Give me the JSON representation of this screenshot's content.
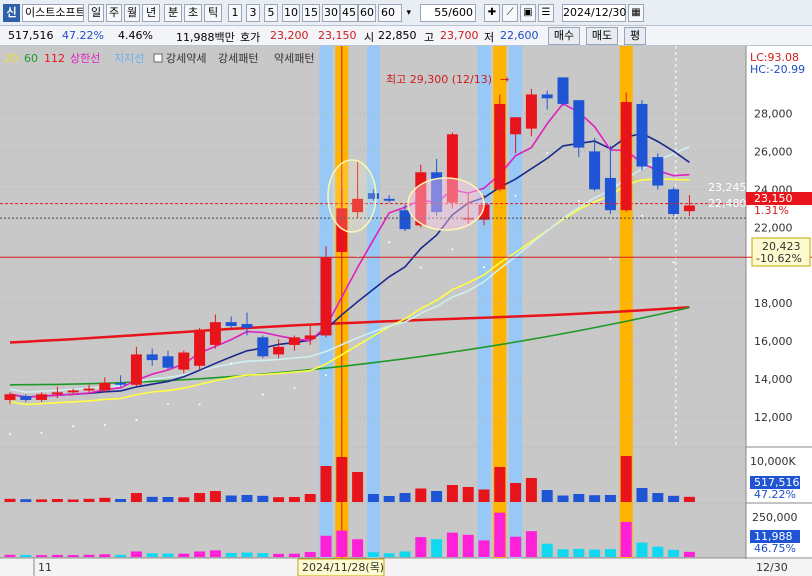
{
  "toolbar": {
    "badge": "신",
    "stock_name": "이스트소프트",
    "periods": [
      "일",
      "주",
      "월",
      "년",
      "분",
      "초",
      "틱"
    ],
    "selected_period": "일",
    "intervals": [
      "1",
      "3",
      "5",
      "10",
      "15",
      "30",
      "45",
      "60"
    ],
    "interval_dropdown": "60",
    "count_value": "55",
    "count_total": "/600",
    "date_value": "2024/12/30"
  },
  "quote": {
    "volume": "517,516",
    "volume_ratio": "47.22%",
    "change_rate": "4.46%",
    "amount": "11,988백만",
    "ask_label": "호가",
    "ask": "23,200",
    "bid": "23,150",
    "open_label": "시",
    "open": "22,850",
    "high_label": "고",
    "high": "23,700",
    "low_label": "저",
    "low": "22,600",
    "buy_button": "매수",
    "sell_button": "매도",
    "eval_button": "평"
  },
  "legend": {
    "ma20": "20",
    "ma60": "60",
    "ma112": "112",
    "upper_limit": "상한선",
    "support": "지지선",
    "check_label": "강세약세",
    "pattern_strong": "강세패턴",
    "pattern_weak": "약세패턴"
  },
  "price_axis": {
    "ticks": [
      "28,000",
      "26,000",
      "24,000",
      "22,000",
      "18,000",
      "16,000",
      "14,000",
      "12,000"
    ],
    "lc": "LC:93.08",
    "hc": "HC:-20.99",
    "current_price": "23,150",
    "current_rate": "1.31%",
    "ref_price": "20,423",
    "ref_rate": "-10.62%",
    "line_a": "23,245",
    "line_b": "22,480"
  },
  "annotation": "최고 29,300 (12/13)",
  "volume_axis": {
    "tick": "10,000K",
    "value": "517,516",
    "ratio": "47.22%"
  },
  "amount_axis": {
    "tick": "250,000",
    "value": "11,988",
    "ratio": "46.75%"
  },
  "date_axis": {
    "month_label": "11",
    "crosshair_date": "2024/11/28(목)",
    "end_date": "12/30"
  },
  "colors": {
    "up": "#e8141b",
    "down": "#1f55d4",
    "ma5": "#e020c0",
    "ma10": "#1a2a8c",
    "ma20": "#ffff40",
    "ma60": "#1f9a2a",
    "ma112": "#e8141b",
    "ma_light": "#cfeff0",
    "highlight_blue": "#98c8f5",
    "highlight_orange": "#ffb400"
  },
  "chart_data": {
    "type": "candlestick",
    "price_min": 11000,
    "price_max": 30500,
    "candles": [
      {
        "o": 12900,
        "h": 13300,
        "l": 12700,
        "c": 13200,
        "v": 320,
        "a": 120
      },
      {
        "o": 13100,
        "h": 13200,
        "l": 12800,
        "c": 12900,
        "v": 280,
        "a": 110
      },
      {
        "o": 12900,
        "h": 13300,
        "l": 12800,
        "c": 13200,
        "v": 260,
        "a": 100
      },
      {
        "o": 13200,
        "h": 13600,
        "l": 13000,
        "c": 13300,
        "v": 300,
        "a": 115
      },
      {
        "o": 13300,
        "h": 13500,
        "l": 13200,
        "c": 13400,
        "v": 250,
        "a": 105
      },
      {
        "o": 13400,
        "h": 13700,
        "l": 13300,
        "c": 13500,
        "v": 320,
        "a": 120
      },
      {
        "o": 13400,
        "h": 14100,
        "l": 13300,
        "c": 13800,
        "v": 420,
        "a": 150
      },
      {
        "o": 13800,
        "h": 14200,
        "l": 13600,
        "c": 13700,
        "v": 300,
        "a": 120
      },
      {
        "o": 13700,
        "h": 15700,
        "l": 13600,
        "c": 15300,
        "v": 900,
        "a": 300
      },
      {
        "o": 15300,
        "h": 15600,
        "l": 14700,
        "c": 15000,
        "v": 520,
        "a": 200
      },
      {
        "o": 15200,
        "h": 15500,
        "l": 14500,
        "c": 14600,
        "v": 500,
        "a": 190
      },
      {
        "o": 14500,
        "h": 15500,
        "l": 14300,
        "c": 15400,
        "v": 470,
        "a": 180
      },
      {
        "o": 14700,
        "h": 16700,
        "l": 14500,
        "c": 16600,
        "v": 900,
        "a": 300
      },
      {
        "o": 15800,
        "h": 17400,
        "l": 15600,
        "c": 17000,
        "v": 1100,
        "a": 360
      },
      {
        "o": 17000,
        "h": 17300,
        "l": 16700,
        "c": 16800,
        "v": 650,
        "a": 220
      },
      {
        "o": 16900,
        "h": 17500,
        "l": 16300,
        "c": 16700,
        "v": 700,
        "a": 240
      },
      {
        "o": 16200,
        "h": 16300,
        "l": 15100,
        "c": 15200,
        "v": 620,
        "a": 210
      },
      {
        "o": 15300,
        "h": 16100,
        "l": 15100,
        "c": 15700,
        "v": 480,
        "a": 170
      },
      {
        "o": 15800,
        "h": 16300,
        "l": 15500,
        "c": 16200,
        "v": 500,
        "a": 180
      },
      {
        "o": 16100,
        "h": 16900,
        "l": 15800,
        "c": 16300,
        "v": 800,
        "a": 270
      },
      {
        "o": 16300,
        "h": 21000,
        "l": 16200,
        "c": 20400,
        "v": 3600,
        "a": 1150
      },
      {
        "o": 20700,
        "h": 24000,
        "l": 20600,
        "c": 23000,
        "v": 4500,
        "a": 1430
      },
      {
        "o": 22800,
        "h": 25500,
        "l": 22500,
        "c": 23500,
        "v": 3000,
        "a": 960
      },
      {
        "o": 23800,
        "h": 24000,
        "l": 23400,
        "c": 23500,
        "v": 800,
        "a": 260
      },
      {
        "o": 23500,
        "h": 23700,
        "l": 23300,
        "c": 23400,
        "v": 600,
        "a": 200
      },
      {
        "o": 22900,
        "h": 23200,
        "l": 21800,
        "c": 21900,
        "v": 900,
        "a": 300
      },
      {
        "o": 22100,
        "h": 25300,
        "l": 22000,
        "c": 24900,
        "v": 1350,
        "a": 1080
      },
      {
        "o": 24900,
        "h": 25600,
        "l": 22600,
        "c": 22800,
        "v": 1100,
        "a": 960
      },
      {
        "o": 23300,
        "h": 27000,
        "l": 23000,
        "c": 26900,
        "v": 1700,
        "a": 1320
      },
      {
        "o": 22400,
        "h": 23800,
        "l": 22100,
        "c": 22500,
        "v": 1500,
        "a": 1200
      },
      {
        "o": 22400,
        "h": 23700,
        "l": 22100,
        "c": 23200,
        "v": 1250,
        "a": 900
      },
      {
        "o": 24000,
        "h": 29000,
        "l": 23900,
        "c": 28500,
        "v": 3500,
        "a": 2400
      },
      {
        "o": 26900,
        "h": 27600,
        "l": 25900,
        "c": 27800,
        "v": 1900,
        "a": 1100
      },
      {
        "o": 27200,
        "h": 29300,
        "l": 26800,
        "c": 29000,
        "v": 2400,
        "a": 1400
      },
      {
        "o": 29000,
        "h": 29200,
        "l": 28200,
        "c": 28800,
        "v": 1200,
        "a": 720
      },
      {
        "o": 29900,
        "h": 29900,
        "l": 28400,
        "c": 28500,
        "v": 650,
        "a": 420
      },
      {
        "o": 28700,
        "h": 28700,
        "l": 25700,
        "c": 26200,
        "v": 800,
        "a": 440
      },
      {
        "o": 26000,
        "h": 26700,
        "l": 23900,
        "c": 24000,
        "v": 680,
        "a": 400
      },
      {
        "o": 24600,
        "h": 26300,
        "l": 22700,
        "c": 22900,
        "v": 700,
        "a": 430
      },
      {
        "o": 22900,
        "h": 29100,
        "l": 22800,
        "c": 28600,
        "v": 4600,
        "a": 1900
      },
      {
        "o": 28500,
        "h": 28700,
        "l": 25000,
        "c": 25200,
        "v": 1400,
        "a": 780
      },
      {
        "o": 25700,
        "h": 25900,
        "l": 24000,
        "c": 24200,
        "v": 900,
        "a": 560
      },
      {
        "o": 24000,
        "h": 24100,
        "l": 22600,
        "c": 22700,
        "v": 620,
        "a": 390
      },
      {
        "o": 22850,
        "h": 23700,
        "l": 22600,
        "c": 23150,
        "v": 517,
        "a": 280
      }
    ],
    "blue_highlights": [
      20,
      21,
      23,
      30,
      32
    ],
    "orange_highlights": [
      21,
      31,
      39
    ],
    "crosshair_index": 21,
    "line_a": 23245,
    "line_b": 22480,
    "ref_level": 20423
  }
}
